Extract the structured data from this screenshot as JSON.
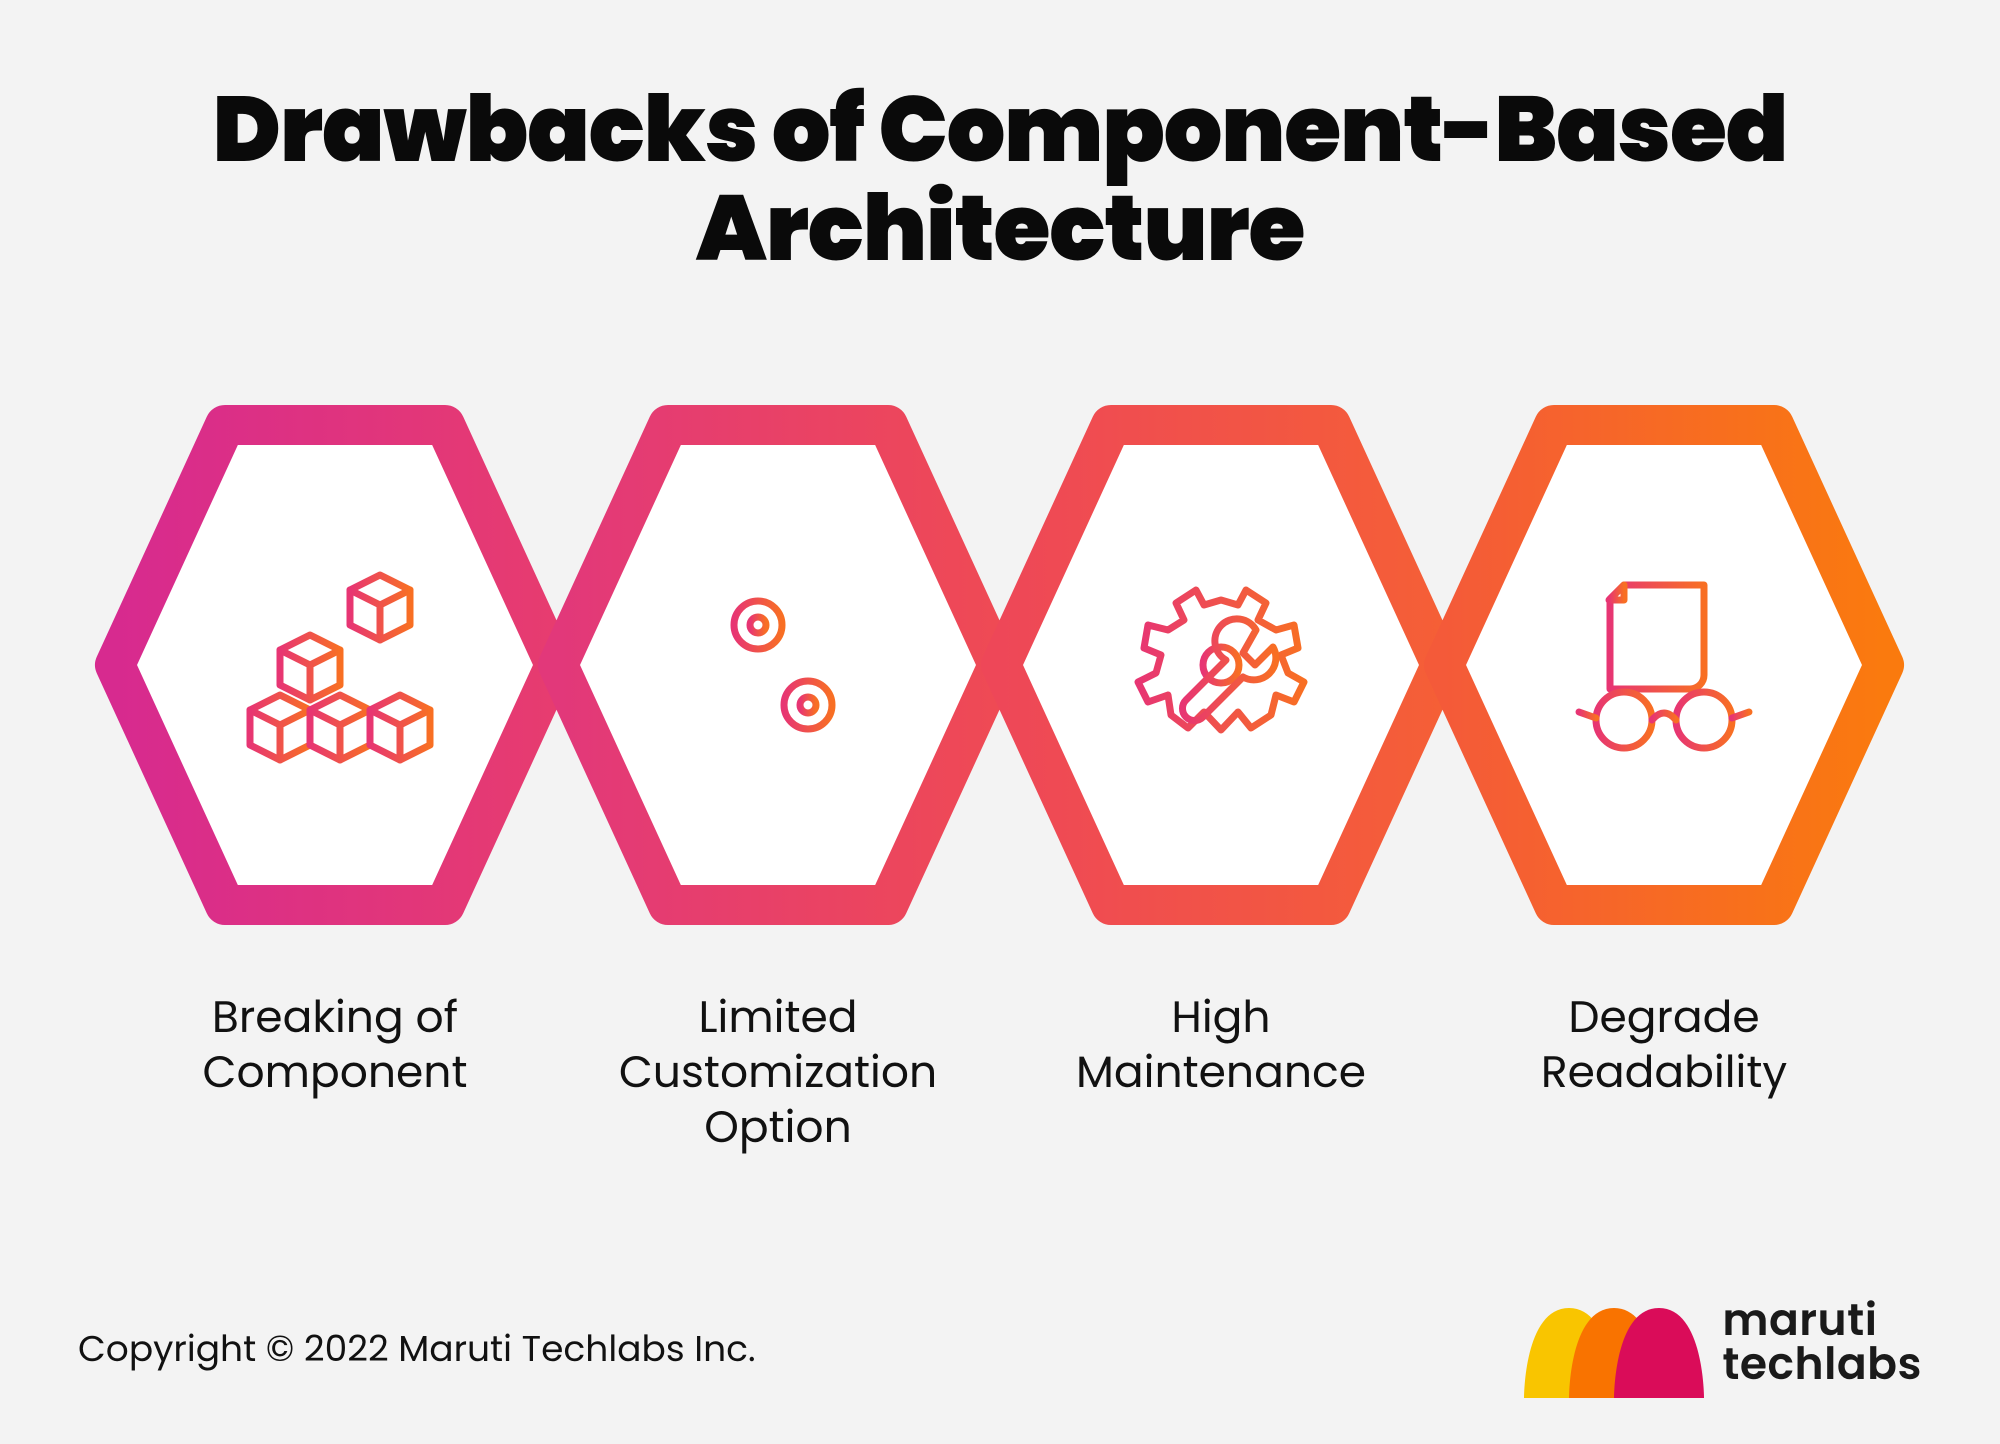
{
  "title_line1": "Drawbacks of Component-Based",
  "title_line2": "Architecture",
  "items": [
    {
      "label": "Breaking of\nComponent",
      "icon": "blocks-icon",
      "stroke_from": "#d72a8f",
      "stroke_to": "#e73c6f"
    },
    {
      "label": "Limited\nCustomization\nOption",
      "icon": "sliders-icon",
      "stroke_from": "#e2387a",
      "stroke_to": "#ef4a54"
    },
    {
      "label": "High\nMaintenance",
      "icon": "gear-icon",
      "stroke_from": "#ee4758",
      "stroke_to": "#f55f36"
    },
    {
      "label": "Degrade\nReadability",
      "icon": "study-icon",
      "stroke_from": "#f45a39",
      "stroke_to": "#fa7a0e"
    }
  ],
  "icon_from": "#e73573",
  "icon_to": "#f86f23",
  "copyright": "Copyright © 2022 Maruti Techlabs Inc.",
  "brand_line1": "maruti",
  "brand_line2": "techlabs",
  "brand_colors": {
    "a": "#f9c500",
    "b": "#f97300",
    "c": "#da0c59"
  }
}
